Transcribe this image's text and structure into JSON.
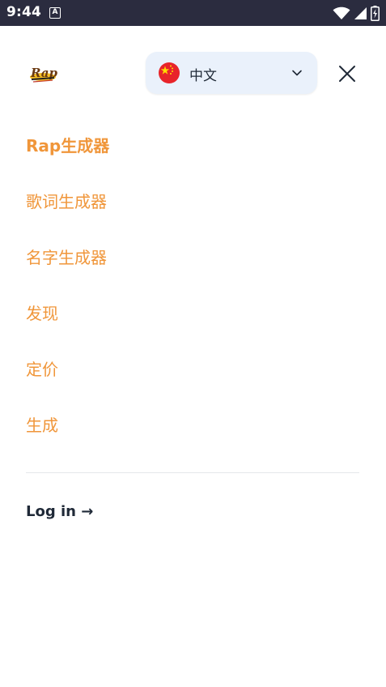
{
  "status_bar": {
    "time": "9:44",
    "notification_icon": "A",
    "icons": [
      "wifi-icon",
      "signal-icon",
      "battery-charging-icon"
    ]
  },
  "header": {
    "logo_icon": "rap-logo-icon",
    "language": {
      "label": "中文",
      "flag_icon": "china-flag-icon",
      "dropdown_icon": "chevron-down-icon"
    },
    "close_icon": "close-icon"
  },
  "nav": {
    "items": [
      {
        "label": "Rap生成器",
        "active": true
      },
      {
        "label": "歌词生成器"
      },
      {
        "label": "名字生成器"
      },
      {
        "label": "发现"
      },
      {
        "label": "定价"
      },
      {
        "label": "生成"
      }
    ]
  },
  "footer": {
    "login_label": "Log in →"
  },
  "colors": {
    "accent": "#f0963a",
    "status_bar": "#2b2c3f",
    "language_bg": "#eaf1fb",
    "text_dark": "#1f2937",
    "divider": "#e5e7eb"
  }
}
